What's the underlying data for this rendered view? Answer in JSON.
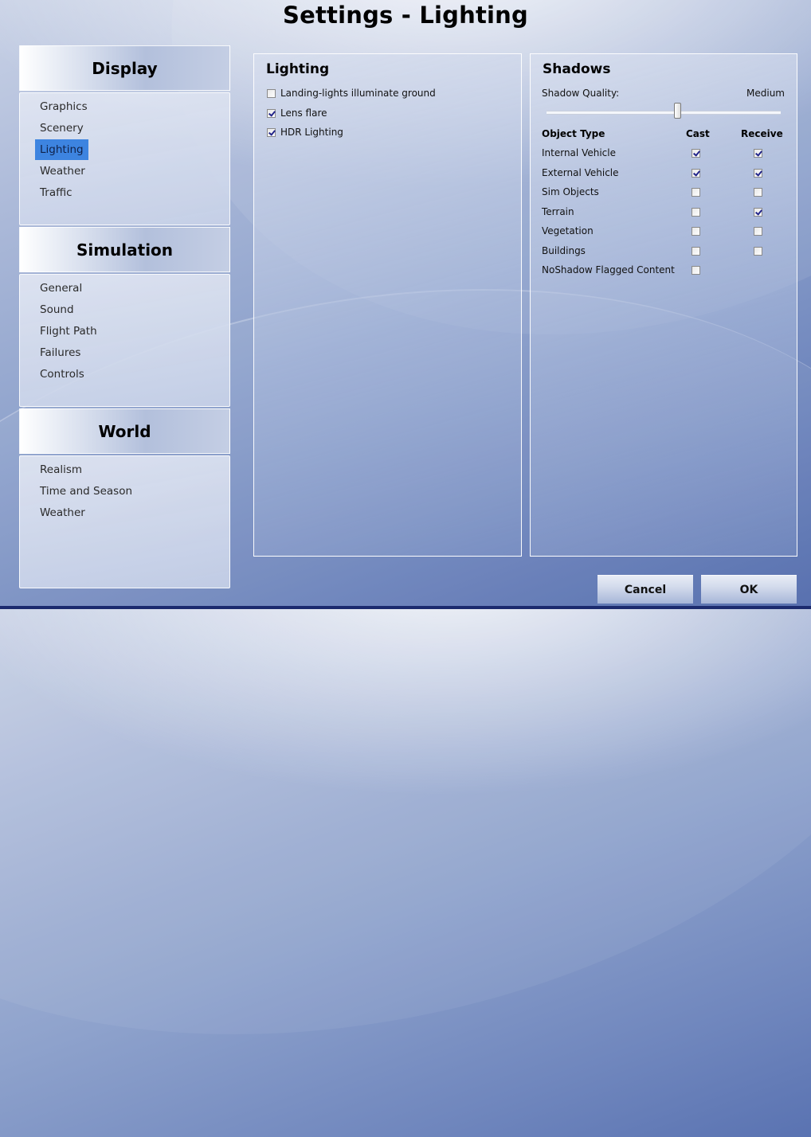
{
  "window": {
    "title": "Settings - Lighting"
  },
  "sidebar": {
    "categories": [
      {
        "label": "Display",
        "items": [
          {
            "label": "Graphics",
            "selected": false
          },
          {
            "label": "Scenery",
            "selected": false
          },
          {
            "label": "Lighting",
            "selected": true
          },
          {
            "label": "Weather",
            "selected": false
          },
          {
            "label": "Traffic",
            "selected": false
          }
        ]
      },
      {
        "label": "Simulation",
        "items": [
          {
            "label": "General",
            "selected": false
          },
          {
            "label": "Sound",
            "selected": false
          },
          {
            "label": "Flight Path",
            "selected": false
          },
          {
            "label": "Failures",
            "selected": false
          },
          {
            "label": "Controls",
            "selected": false
          }
        ]
      },
      {
        "label": "World",
        "items": [
          {
            "label": "Realism",
            "selected": false
          },
          {
            "label": "Time and Season",
            "selected": false
          },
          {
            "label": "Weather",
            "selected": false
          }
        ]
      }
    ]
  },
  "lighting_panel": {
    "title": "Lighting",
    "options": [
      {
        "label": "Landing-lights illuminate ground",
        "checked": false
      },
      {
        "label": "Lens flare",
        "checked": true
      },
      {
        "label": "HDR Lighting",
        "checked": true
      }
    ]
  },
  "shadows_panel": {
    "title": "Shadows",
    "quality_label": "Shadow Quality:",
    "quality_value": "Medium",
    "quality_slider_fraction": 0.5,
    "columns": {
      "object_type": "Object Type",
      "cast": "Cast",
      "receive": "Receive"
    },
    "rows": [
      {
        "label": "Internal Vehicle",
        "cast": true,
        "receive": true
      },
      {
        "label": "External Vehicle",
        "cast": true,
        "receive": true
      },
      {
        "label": "Sim Objects",
        "cast": false,
        "receive": false
      },
      {
        "label": "Terrain",
        "cast": false,
        "receive": true
      },
      {
        "label": "Vegetation",
        "cast": false,
        "receive": false
      },
      {
        "label": "Buildings",
        "cast": false,
        "receive": false
      },
      {
        "label": "NoShadow Flagged Content",
        "cast": false,
        "receive": null
      }
    ]
  },
  "footer": {
    "cancel_label": "Cancel",
    "ok_label": "OK"
  },
  "colors": {
    "selection": "#3d84e0",
    "checkmark": "#22248a",
    "bottom_bar": "#1b2a6e"
  }
}
